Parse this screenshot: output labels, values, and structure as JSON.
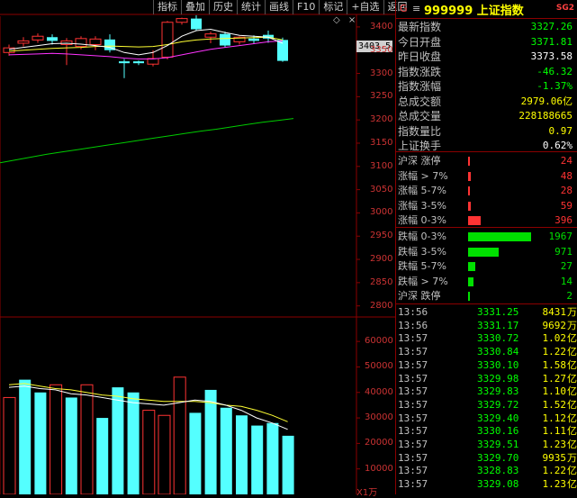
{
  "toolbar": {
    "items": [
      "指标",
      "叠加",
      "历史",
      "统计",
      "画线",
      "F10",
      "标记",
      "+自选",
      "返回"
    ]
  },
  "chart_data": [
    {
      "type": "candlestick",
      "price_axis": {
        "ticks": [
          3400,
          3350,
          3300,
          3250,
          3200,
          3150,
          3100,
          3050,
          3000,
          2950,
          2900,
          2850,
          2800
        ],
        "ylim": [
          2780,
          3425
        ]
      },
      "current_price_label": "3403.5",
      "candles": [
        {
          "o": 3345,
          "c": 3355,
          "h": 3362,
          "l": 3338,
          "up": true
        },
        {
          "o": 3365,
          "c": 3370,
          "h": 3378,
          "l": 3358,
          "up": true
        },
        {
          "o": 3372,
          "c": 3380,
          "h": 3386,
          "l": 3366,
          "up": true
        },
        {
          "o": 3378,
          "c": 3370,
          "h": 3384,
          "l": 3362,
          "up": false
        },
        {
          "o": 3362,
          "c": 3370,
          "h": 3376,
          "l": 3318,
          "up": true
        },
        {
          "o": 3358,
          "c": 3375,
          "h": 3380,
          "l": 3352,
          "up": true
        },
        {
          "o": 3374,
          "c": 3362,
          "h": 3380,
          "l": 3350,
          "up": true
        },
        {
          "o": 3373,
          "c": 3350,
          "h": 3384,
          "l": 3345,
          "up": false
        },
        {
          "o": 3326,
          "c": 3322,
          "h": 3331,
          "l": 3290,
          "up": false
        },
        {
          "o": 3326,
          "c": 3322,
          "h": 3328,
          "l": 3318,
          "up": false
        },
        {
          "o": 3320,
          "c": 3332,
          "h": 3350,
          "l": 3315,
          "up": true
        },
        {
          "o": 3335,
          "c": 3410,
          "h": 3413,
          "l": 3330,
          "up": true
        },
        {
          "o": 3410,
          "c": 3418,
          "h": 3420,
          "l": 3405,
          "up": true
        },
        {
          "o": 3418,
          "c": 3395,
          "h": 3425,
          "l": 3392,
          "up": false
        },
        {
          "o": 3378,
          "c": 3385,
          "h": 3390,
          "l": 3365,
          "up": true
        },
        {
          "o": 3385,
          "c": 3360,
          "h": 3390,
          "l": 3356,
          "up": false
        },
        {
          "o": 3368,
          "c": 3378,
          "h": 3380,
          "l": 3362,
          "up": true
        },
        {
          "o": 3375,
          "c": 3370,
          "h": 3382,
          "l": 3364,
          "up": false
        },
        {
          "o": 3383,
          "c": 3375,
          "h": 3392,
          "l": 3366,
          "up": false
        },
        {
          "o": 3372,
          "c": 3327,
          "h": 3377,
          "l": 3325,
          "up": false
        }
      ],
      "ma_white": [
        3352,
        3356,
        3360,
        3364,
        3365,
        3363,
        3360,
        3356,
        3345,
        3340,
        3345,
        3360,
        3380,
        3392,
        3395,
        3388,
        3382,
        3380,
        3378,
        3365
      ],
      "ma_yellow": [
        3348,
        3350,
        3352,
        3354,
        3355,
        3356,
        3358,
        3359,
        3358,
        3357,
        3358,
        3362,
        3368,
        3372,
        3374,
        3375,
        3376,
        3377,
        3378,
        3372
      ],
      "ma_magenta": [
        3340,
        3341,
        3342,
        3343,
        3342,
        3340,
        3338,
        3336,
        3333,
        3331,
        3331,
        3334,
        3340,
        3346,
        3352,
        3356,
        3360,
        3364,
        3368,
        3370
      ],
      "ma_green": [
        3108,
        3114,
        3120,
        3126,
        3131,
        3136,
        3141,
        3146,
        3151,
        3156,
        3161,
        3166,
        3171,
        3176,
        3180,
        3185,
        3190,
        3195,
        3199,
        3203
      ]
    },
    {
      "type": "bar",
      "volume_axis": {
        "ticks": [
          60000,
          50000,
          40000,
          30000,
          20000,
          10000
        ],
        "ylim": [
          0,
          65000
        ],
        "unit": "X1万"
      },
      "values": [
        38000,
        45000,
        40000,
        43000,
        38000,
        43000,
        30000,
        42000,
        40000,
        33000,
        31000,
        46000,
        32000,
        41000,
        34000,
        31000,
        27000,
        28000,
        23000
      ],
      "ma_yellow": [
        43000,
        43500,
        42500,
        41500,
        41000,
        40000,
        39000,
        38500,
        37500,
        37000,
        36500,
        36500,
        36500,
        36000,
        35000,
        34500,
        33000,
        31000,
        28500
      ],
      "ma_white": [
        42000,
        42500,
        41500,
        41000,
        39500,
        39000,
        38000,
        37000,
        36000,
        35500,
        35000,
        36000,
        37000,
        36500,
        35000,
        33000,
        30000,
        28000,
        25500
      ]
    }
  ],
  "header": {
    "g": "G",
    "eq": "≡",
    "title": "999999 上证指数",
    "sg": "SG2"
  },
  "stats": [
    {
      "label": "最新指数",
      "value": "3327.26",
      "color": "#00ff00"
    },
    {
      "label": "今日开盘",
      "value": "3371.81",
      "color": "#00ff00"
    },
    {
      "label": "昨日收盘",
      "value": "3373.58",
      "color": "#ffffff"
    },
    {
      "label": "指数涨跌",
      "value": "-46.32",
      "color": "#00ff00"
    },
    {
      "label": "指数涨幅",
      "value": "-1.37%",
      "color": "#00ff00"
    },
    {
      "label": "总成交额",
      "value": "2979.06亿",
      "color": "#ffff00"
    },
    {
      "label": "总成交量",
      "value": "228188665",
      "color": "#ffff00"
    },
    {
      "label": "指数量比",
      "value": "0.97",
      "color": "#ffff00"
    },
    {
      "label": "上证换手",
      "value": "0.62%",
      "color": "#ffffff"
    }
  ],
  "up_dist": [
    {
      "label": "沪深 涨停",
      "value": "24",
      "bar": 0.03
    },
    {
      "label": "涨幅 > 7%",
      "value": "48",
      "bar": 0.04
    },
    {
      "label": "涨幅 5-7%",
      "value": "28",
      "bar": 0.03
    },
    {
      "label": "涨幅 3-5%",
      "value": "59",
      "bar": 0.04
    },
    {
      "label": "涨幅 0-3%",
      "value": "396",
      "bar": 0.2
    }
  ],
  "down_dist": [
    {
      "label": "跌幅 0-3%",
      "value": "1967",
      "bar": 1.0
    },
    {
      "label": "跌幅 3-5%",
      "value": "971",
      "bar": 0.49
    },
    {
      "label": "跌幅 5-7%",
      "value": "27",
      "bar": 0.12
    },
    {
      "label": "跌幅 > 7%",
      "value": "14",
      "bar": 0.08
    },
    {
      "label": "沪深 跌停",
      "value": "2",
      "bar": 0.02
    }
  ],
  "colors": {
    "up": "#ff3333",
    "down": "#00e000",
    "cyan": "#54ffff"
  },
  "ticks": [
    {
      "time": "13:56",
      "price": "3331.25",
      "vol": "8431",
      "unit": "万"
    },
    {
      "time": "13:56",
      "price": "3331.17",
      "vol": "9692",
      "unit": "万"
    },
    {
      "time": "13:57",
      "price": "3330.72",
      "vol": "1.02",
      "unit": "亿"
    },
    {
      "time": "13:57",
      "price": "3330.84",
      "vol": "1.22",
      "unit": "亿"
    },
    {
      "time": "13:57",
      "price": "3330.10",
      "vol": "1.58",
      "unit": "亿"
    },
    {
      "time": "13:57",
      "price": "3329.98",
      "vol": "1.27",
      "unit": "亿"
    },
    {
      "time": "13:57",
      "price": "3329.83",
      "vol": "1.10",
      "unit": "亿"
    },
    {
      "time": "13:57",
      "price": "3329.72",
      "vol": "1.52",
      "unit": "亿"
    },
    {
      "time": "13:57",
      "price": "3329.40",
      "vol": "1.12",
      "unit": "亿"
    },
    {
      "time": "13:57",
      "price": "3330.16",
      "vol": "1.11",
      "unit": "亿"
    },
    {
      "time": "13:57",
      "price": "3329.51",
      "vol": "1.23",
      "unit": "亿"
    },
    {
      "time": "13:57",
      "price": "3329.70",
      "vol": "9935",
      "unit": "万"
    },
    {
      "time": "13:57",
      "price": "3328.83",
      "vol": "1.22",
      "unit": "亿"
    },
    {
      "time": "13:57",
      "price": "3329.08",
      "vol": "1.23",
      "unit": "亿"
    }
  ]
}
